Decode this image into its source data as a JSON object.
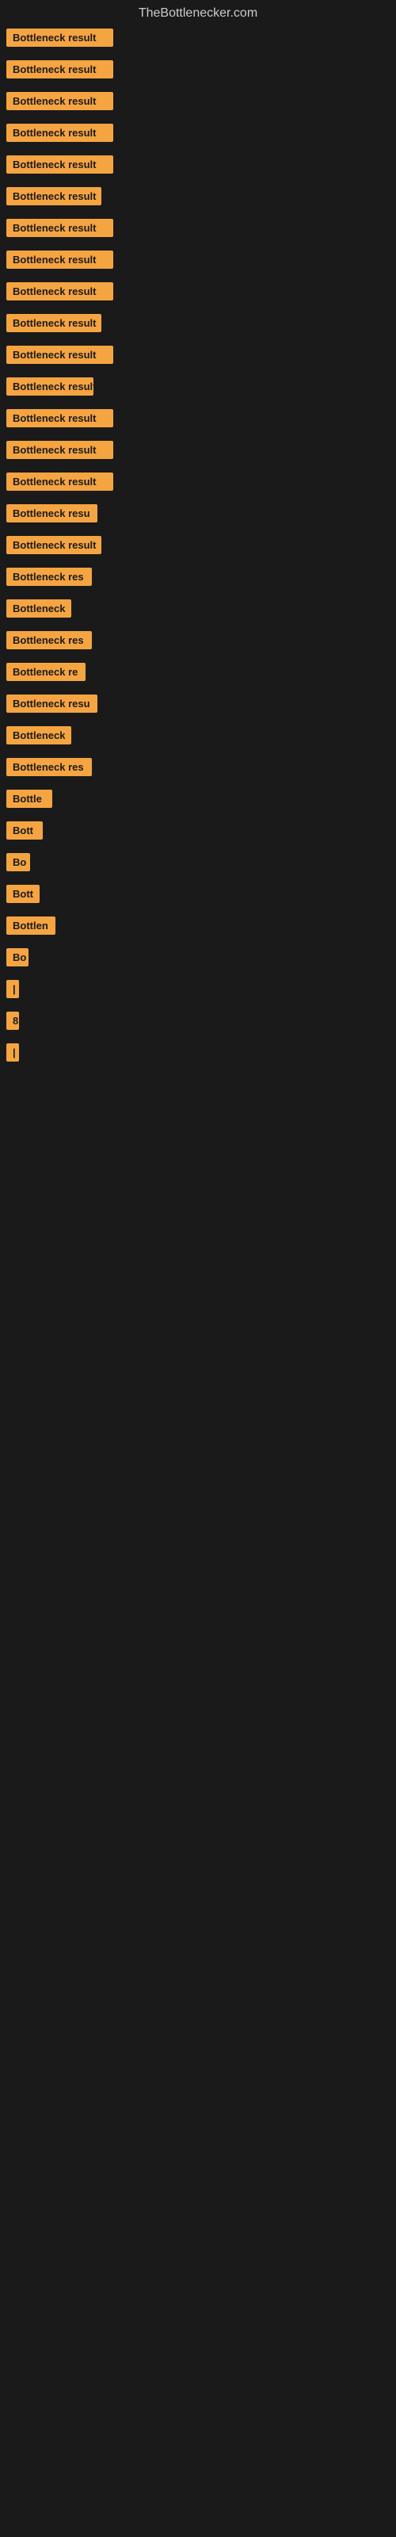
{
  "site": {
    "title": "TheBottlenecker.com"
  },
  "items": [
    {
      "id": 1,
      "label": "Bottleneck result",
      "width": 135
    },
    {
      "id": 2,
      "label": "Bottleneck result",
      "width": 135
    },
    {
      "id": 3,
      "label": "Bottleneck result",
      "width": 135
    },
    {
      "id": 4,
      "label": "Bottleneck result",
      "width": 135
    },
    {
      "id": 5,
      "label": "Bottleneck result",
      "width": 135
    },
    {
      "id": 6,
      "label": "Bottleneck result",
      "width": 120
    },
    {
      "id": 7,
      "label": "Bottleneck result",
      "width": 135
    },
    {
      "id": 8,
      "label": "Bottleneck result",
      "width": 135
    },
    {
      "id": 9,
      "label": "Bottleneck result",
      "width": 135
    },
    {
      "id": 10,
      "label": "Bottleneck result",
      "width": 120
    },
    {
      "id": 11,
      "label": "Bottleneck result",
      "width": 135
    },
    {
      "id": 12,
      "label": "Bottleneck result",
      "width": 110
    },
    {
      "id": 13,
      "label": "Bottleneck result",
      "width": 135
    },
    {
      "id": 14,
      "label": "Bottleneck result",
      "width": 135
    },
    {
      "id": 15,
      "label": "Bottleneck result",
      "width": 135
    },
    {
      "id": 16,
      "label": "Bottleneck resu",
      "width": 115
    },
    {
      "id": 17,
      "label": "Bottleneck result",
      "width": 120
    },
    {
      "id": 18,
      "label": "Bottleneck res",
      "width": 108
    },
    {
      "id": 19,
      "label": "Bottleneck",
      "width": 82
    },
    {
      "id": 20,
      "label": "Bottleneck res",
      "width": 108
    },
    {
      "id": 21,
      "label": "Bottleneck re",
      "width": 100
    },
    {
      "id": 22,
      "label": "Bottleneck resu",
      "width": 115
    },
    {
      "id": 23,
      "label": "Bottleneck",
      "width": 82
    },
    {
      "id": 24,
      "label": "Bottleneck res",
      "width": 108
    },
    {
      "id": 25,
      "label": "Bottle",
      "width": 58
    },
    {
      "id": 26,
      "label": "Bott",
      "width": 46
    },
    {
      "id": 27,
      "label": "Bo",
      "width": 30
    },
    {
      "id": 28,
      "label": "Bott",
      "width": 42
    },
    {
      "id": 29,
      "label": "Bottlen",
      "width": 62
    },
    {
      "id": 30,
      "label": "Bo",
      "width": 28
    },
    {
      "id": 31,
      "label": "|",
      "width": 10
    },
    {
      "id": 32,
      "label": "8",
      "width": 14
    },
    {
      "id": 33,
      "label": "|",
      "width": 10
    },
    {
      "id": 34,
      "label": "",
      "width": 8
    },
    {
      "id": 35,
      "label": "",
      "width": 6
    }
  ]
}
